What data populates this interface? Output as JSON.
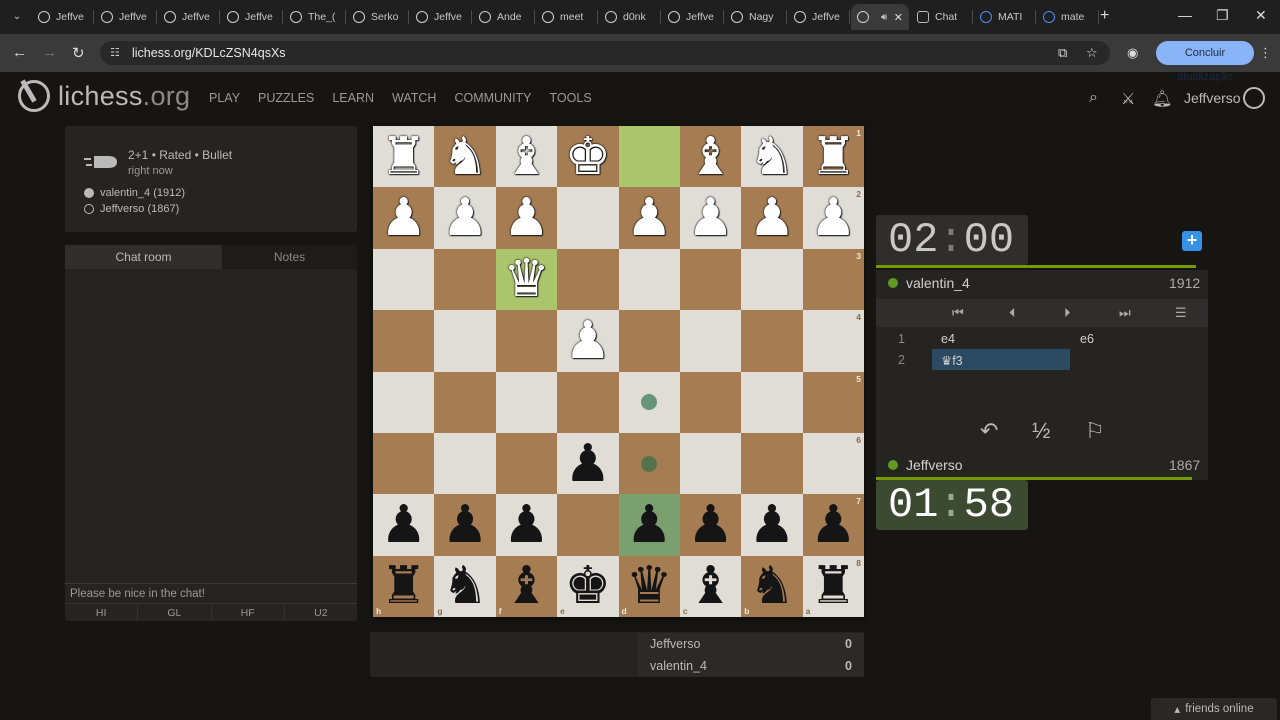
{
  "browser": {
    "tabs": [
      {
        "label": "Jeffve",
        "icon": "lichess-icon"
      },
      {
        "label": "Jeffve",
        "icon": "lichess-icon"
      },
      {
        "label": "Jeffve",
        "icon": "lichess-icon"
      },
      {
        "label": "Jeffve",
        "icon": "lichess-icon"
      },
      {
        "label": "The_(",
        "icon": "lichess-icon"
      },
      {
        "label": "Serko",
        "icon": "lichess-icon"
      },
      {
        "label": "Jeffve",
        "icon": "lichess-icon"
      },
      {
        "label": "Ande",
        "icon": "lichess-icon"
      },
      {
        "label": "meet",
        "icon": "lichess-icon"
      },
      {
        "label": "d0nk",
        "icon": "lichess-icon"
      },
      {
        "label": "Jeffve",
        "icon": "lichess-icon"
      },
      {
        "label": "Nagy",
        "icon": "lichess-icon"
      },
      {
        "label": "Jeffve",
        "icon": "lichess-icon"
      },
      {
        "label": "",
        "icon": "lichess-icon",
        "active": true
      },
      {
        "label": "Chat",
        "icon": "chatgpt-icon"
      },
      {
        "label": "MATI",
        "icon": "google-icon"
      },
      {
        "label": "mate",
        "icon": "google-icon"
      }
    ],
    "url": "lichess.org/KDLcZSN4qsXs",
    "update_label": "Concluir atualização"
  },
  "site": {
    "logo_main": "lichess",
    "logo_tld": ".org",
    "nav": [
      "PLAY",
      "PUZZLES",
      "LEARN",
      "WATCH",
      "COMMUNITY",
      "TOOLS"
    ],
    "username": "Jeffverso"
  },
  "game": {
    "title": "2+1 • Rated • Bullet",
    "time": "right now",
    "white_player": "valentin_4 (1912)",
    "black_player": "Jeffverso (1867)"
  },
  "chat": {
    "tabs": [
      "Chat room",
      "Notes"
    ],
    "placeholder": "Please be nice in the chat!",
    "presets": [
      "HI",
      "GL",
      "HF",
      "U2"
    ]
  },
  "board": {
    "orientation": "black",
    "ranks": [
      "1",
      "2",
      "3",
      "4",
      "5",
      "6",
      "7",
      "8"
    ],
    "files": [
      "h",
      "g",
      "f",
      "e",
      "d",
      "c",
      "b",
      "a"
    ],
    "rows": [
      [
        "wR",
        "wN",
        "wB",
        "wK",
        "",
        "wB",
        "wN",
        "wR"
      ],
      [
        "wP",
        "wP",
        "wP",
        "",
        "wP",
        "wP",
        "wP",
        "wP"
      ],
      [
        "",
        "",
        "wQ",
        "",
        "",
        "",
        "",
        ""
      ],
      [
        "",
        "",
        "",
        "wP",
        "",
        "",
        "",
        ""
      ],
      [
        "",
        "",
        "",
        "",
        "",
        "",
        "",
        ""
      ],
      [
        "",
        "",
        "",
        "bP",
        "",
        "",
        "",
        ""
      ],
      [
        "bP",
        "bP",
        "bP",
        "",
        "bP",
        "bP",
        "bP",
        "bP"
      ],
      [
        "bR",
        "bN",
        "bB",
        "bK",
        "bQ",
        "bB",
        "bN",
        "bR"
      ]
    ],
    "highlight_squares": [
      "d1",
      "f3"
    ],
    "selected_square": "d7",
    "move_dots": [
      "d5",
      "d6"
    ]
  },
  "scores": [
    {
      "name": "Jeffverso",
      "score": "0"
    },
    {
      "name": "valentin_4",
      "score": "0"
    }
  ],
  "clocks": {
    "top": {
      "min": "02",
      "sec": "00"
    },
    "bottom": {
      "min": "01",
      "sec": "58"
    }
  },
  "players": {
    "top": {
      "name": "valentin_4",
      "rating": "1912"
    },
    "bottom": {
      "name": "Jeffverso",
      "rating": "1867"
    }
  },
  "moves": [
    {
      "num": "1",
      "white": "e4",
      "black": "e6"
    },
    {
      "num": "2",
      "white": "♛f3",
      "black": ""
    }
  ],
  "actions": {
    "draw_label": "½"
  },
  "footer": {
    "friends_label": "friends online"
  }
}
